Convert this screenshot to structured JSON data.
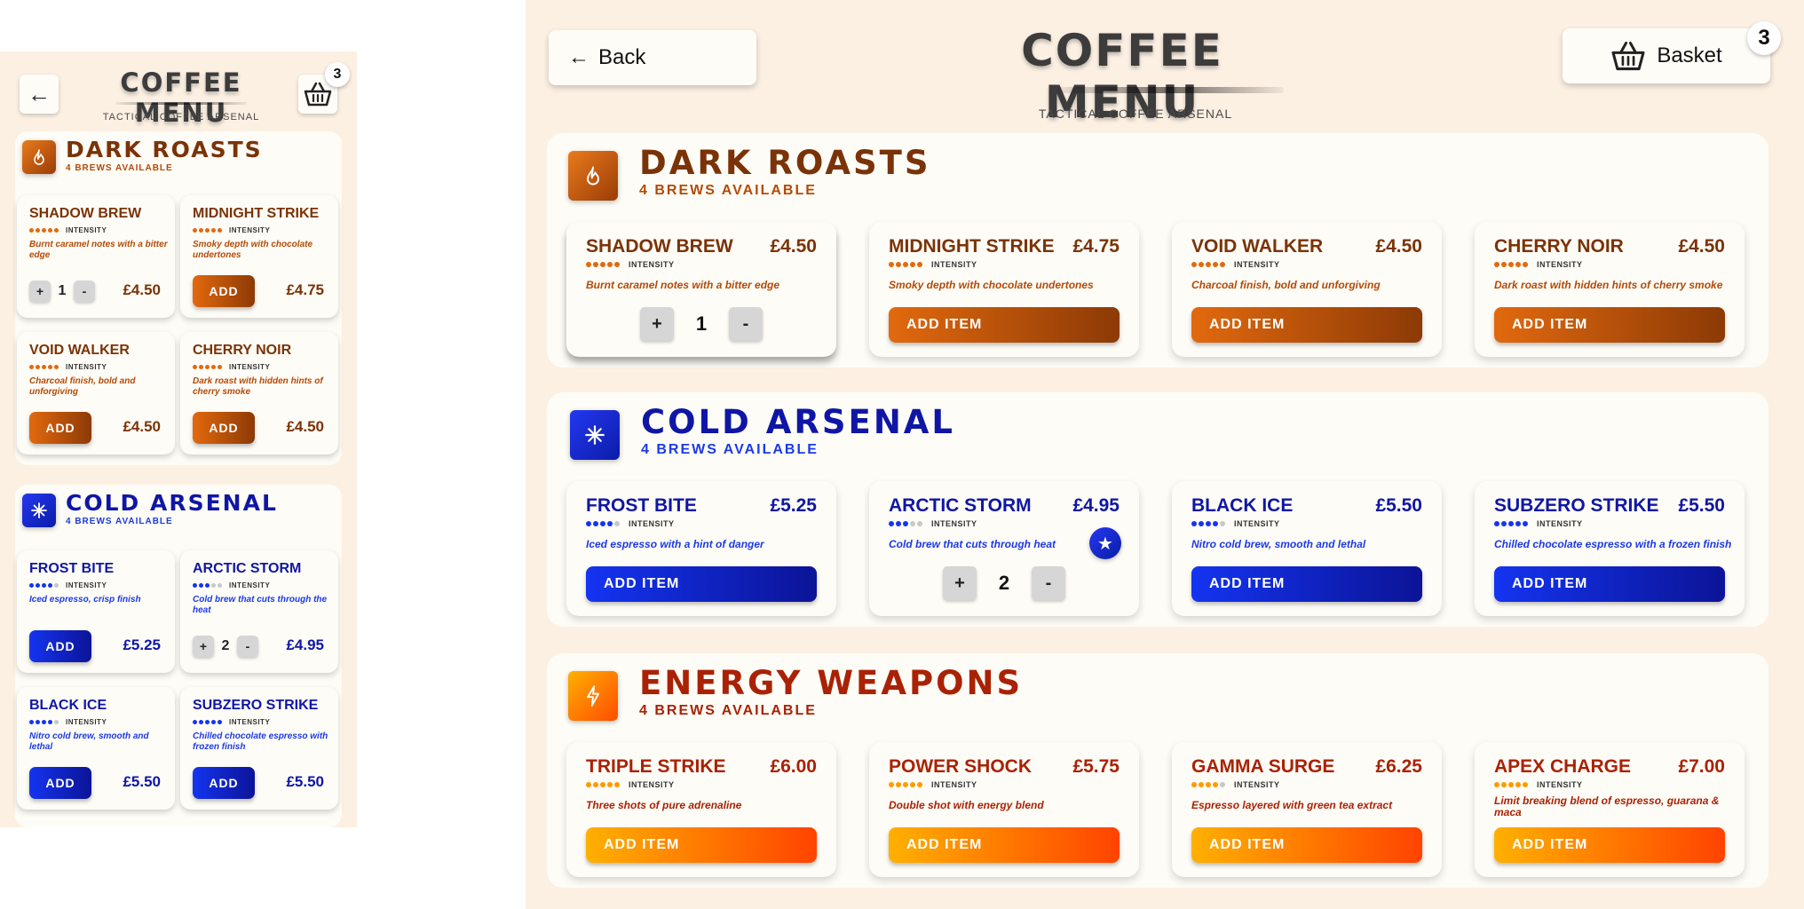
{
  "header": {
    "title": "COFFEE MENU",
    "subtitle": "TACTICAL COFFEE ARSENAL",
    "back_label": "Back",
    "basket_label": "Basket",
    "basket_count": "3",
    "back_icon": "←"
  },
  "colors": {
    "background": "#fcf0e3",
    "card": "#fefcf6",
    "dark_roasts": "#7a3308",
    "cold_arsenal": "#0f16a6",
    "energy_weapons": "#a92205"
  },
  "mobile": {
    "sections": [
      {
        "title": "DARK ROASTS",
        "subtitle": "4 BREWS AVAILABLE",
        "icon": "flame-icon",
        "items": [
          {
            "name": "SHADOW BREW",
            "intensity": 5,
            "intensity_label": "INTENSITY",
            "desc": "Burnt caramel notes with a bitter edge",
            "price": "£4.50",
            "qty": "1"
          },
          {
            "name": "MIDNIGHT STRIKE",
            "intensity": 5,
            "intensity_label": "INTENSITY",
            "desc": "Smoky depth with chocolate undertones",
            "price": "£4.75",
            "button": "ADD"
          },
          {
            "name": "VOID WALKER",
            "intensity": 5,
            "intensity_label": "INTENSITY",
            "desc": "Charcoal finish, bold and unforgiving",
            "price": "£4.50",
            "button": "ADD"
          },
          {
            "name": "CHERRY NOIR",
            "intensity": 5,
            "intensity_label": "INTENSITY",
            "desc": "Dark roast with hidden hints of cherry smoke",
            "price": "£4.50",
            "button": "ADD"
          }
        ]
      },
      {
        "title": "COLD ARSENAL",
        "subtitle": "4 BREWS AVAILABLE",
        "icon": "snowflake-icon",
        "items": [
          {
            "name": "FROST BITE",
            "intensity": 4,
            "intensity_label": "INTENSITY",
            "desc": "Iced espresso, crisp finish",
            "price": "£5.25",
            "button": "ADD"
          },
          {
            "name": "ARCTIC STORM",
            "intensity": 3,
            "intensity_label": "INTENSITY",
            "desc": "Cold brew that cuts through the heat",
            "price": "£4.95",
            "qty": "2"
          },
          {
            "name": "BLACK ICE",
            "intensity": 4,
            "intensity_label": "INTENSITY",
            "desc": "Nitro cold brew, smooth and lethal",
            "price": "£5.50",
            "button": "ADD"
          },
          {
            "name": "SUBZERO STRIKE",
            "intensity": 5,
            "intensity_label": "INTENSITY",
            "desc": "Chilled chocolate espresso with frozen finish",
            "price": "£5.50",
            "button": "ADD"
          }
        ]
      }
    ]
  },
  "desktop": {
    "sections": [
      {
        "title": "DARK ROASTS",
        "subtitle": "4 BREWS AVAILABLE",
        "icon": "flame-icon",
        "items": [
          {
            "name": "SHADOW BREW",
            "intensity": 5,
            "intensity_label": "INTENSITY",
            "desc": "Burnt caramel notes with a bitter edge",
            "price": "£4.50",
            "qty": "1"
          },
          {
            "name": "MIDNIGHT STRIKE",
            "intensity": 5,
            "intensity_label": "INTENSITY",
            "desc": "Smoky depth with chocolate undertones",
            "price": "£4.75",
            "button": "ADD ITEM"
          },
          {
            "name": "VOID WALKER",
            "intensity": 5,
            "intensity_label": "INTENSITY",
            "desc": "Charcoal finish, bold and unforgiving",
            "price": "£4.50",
            "button": "ADD ITEM"
          },
          {
            "name": "CHERRY NOIR",
            "intensity": 5,
            "intensity_label": "INTENSITY",
            "desc": "Dark roast with hidden hints of cherry smoke",
            "price": "£4.50",
            "button": "ADD ITEM"
          }
        ]
      },
      {
        "title": "COLD ARSENAL",
        "subtitle": "4 BREWS AVAILABLE",
        "icon": "snowflake-icon",
        "items": [
          {
            "name": "FROST BITE",
            "intensity": 4,
            "intensity_label": "INTENSITY",
            "desc": "Iced espresso with a hint of danger",
            "price": "£5.25",
            "button": "ADD ITEM"
          },
          {
            "name": "ARCTIC STORM",
            "intensity": 3,
            "intensity_label": "INTENSITY",
            "desc": "Cold brew that cuts through heat",
            "price": "£4.95",
            "qty": "2",
            "badge": "star-icon"
          },
          {
            "name": "BLACK ICE",
            "intensity": 4,
            "intensity_label": "INTENSITY",
            "desc": "Nitro cold brew, smooth and lethal",
            "price": "£5.50",
            "button": "ADD ITEM"
          },
          {
            "name": "SUBZERO STRIKE",
            "intensity": 5,
            "intensity_label": "INTENSITY",
            "desc": "Chilled chocolate espresso with a frozen finish",
            "price": "£5.50",
            "button": "ADD ITEM"
          }
        ]
      },
      {
        "title": "ENERGY WEAPONS",
        "subtitle": "4 BREWS AVAILABLE",
        "icon": "lightning-icon",
        "items": [
          {
            "name": "TRIPLE STRIKE",
            "intensity": 5,
            "intensity_label": "INTENSITY",
            "desc": "Three shots of pure adrenaline",
            "price": "£6.00",
            "button": "ADD ITEM"
          },
          {
            "name": "POWER SHOCK",
            "intensity": 5,
            "intensity_label": "INTENSITY",
            "desc": "Double shot with energy blend",
            "price": "£5.75",
            "button": "ADD ITEM"
          },
          {
            "name": "GAMMA SURGE",
            "intensity": 4,
            "intensity_label": "INTENSITY",
            "desc": "Espresso layered with green tea extract",
            "price": "£6.25",
            "button": "ADD ITEM"
          },
          {
            "name": "APEX CHARGE",
            "intensity": 5,
            "intensity_label": "INTENSITY",
            "desc": "Limit breaking blend of espresso, guarana & maca",
            "price": "£7.00",
            "button": "ADD ITEM"
          }
        ]
      }
    ]
  }
}
